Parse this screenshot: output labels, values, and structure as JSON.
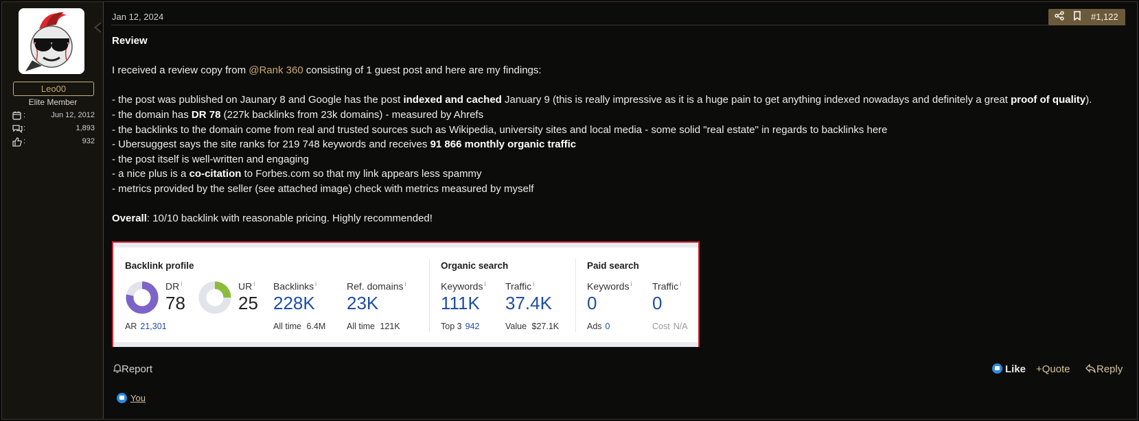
{
  "user": {
    "name": "Leo00",
    "title": "Elite Member",
    "stats": [
      {
        "icon": "calendar-icon",
        "value": "Jun 12, 2012"
      },
      {
        "icon": "messages-icon",
        "value": "1,893"
      },
      {
        "icon": "reactions-icon",
        "value": "932"
      }
    ]
  },
  "post": {
    "date": "Jan 12, 2024",
    "number": "#1,122",
    "heading": "Review",
    "intro_before": "I received a review copy from ",
    "mention": "@Rank 360",
    "intro_after": " consisting of 1 guest post and here are my findings:",
    "l1_a": "- the post was published on Jaunary 8 and Google has the post ",
    "l1_b": "indexed and cached",
    "l1_c": " January 9 (this is really impressive as it is a huge pain to get anything indexed nowadays and definitely a great ",
    "l1_d": "proof of quality",
    "l1_e": ").",
    "l2_a": "- the domain has ",
    "l2_b": "DR 78",
    "l2_c": " (227k backlinks from 23k domains) - measured by Ahrefs",
    "l3": "- the backlinks to the domain come from real and trusted sources such as Wikipedia, university sites and local media - some solid \"real estate\" in regards to backlinks here",
    "l4_a": "- Ubersuggest says the site ranks for 219 748 keywords and receives ",
    "l4_b": "91 866 monthly organic traffic",
    "l5": "- the post itself is well-written and engaging",
    "l6_a": "- a nice plus is a ",
    "l6_b": "co-citation",
    "l6_c": " to Forbes.com so that my link appears less spammy",
    "l7": "- metrics provided by the seller (see attached image) check with metrics measured by myself",
    "overall_a": "Overall",
    "overall_b": ": 10/10 backlink with reasonable pricing. Highly recommended!"
  },
  "attachment": {
    "backlink_profile": "Backlink profile",
    "organic_search": "Organic search",
    "paid_search": "Paid search",
    "dr_label": "DR",
    "dr_value": "78",
    "dr_fraction": 0.78,
    "ur_label": "UR",
    "ur_value": "25",
    "ur_fraction": 0.25,
    "ar_label": "AR",
    "ar_value": "21,301",
    "info": "i",
    "backlinks_label": "Backlinks",
    "backlinks_value": "228K",
    "backlinks_all_time": "All time",
    "backlinks_all_time_value": "6.4M",
    "refdomains_label": "Ref. domains",
    "refdomains_value": "23K",
    "refdomains_all_time": "All time",
    "refdomains_all_time_value": "121K",
    "keywords_label": "Keywords",
    "keywords_value": "111K",
    "top3_label": "Top 3",
    "top3_value": "942",
    "traffic_label": "Traffic",
    "traffic_value": "37.4K",
    "value_label": "Value",
    "value_value": "$27.1K",
    "paid_keywords_label": "Keywords",
    "paid_keywords_value": "0",
    "ads_label": "Ads",
    "ads_value": "0",
    "paid_traffic_label": "Traffic",
    "paid_traffic_value": "0",
    "cost_label": "Cost",
    "cost_value": "N/A"
  },
  "footer": {
    "report": "Report",
    "like": "Like",
    "quote": "Quote",
    "reply": "Reply",
    "reacted_by": "You"
  },
  "colors": {
    "accent_gold": "#c9a96c",
    "post_actions_bg": "#6b5a3a",
    "dr_purple": "#7c63c8",
    "ur_green": "#8cbc3a",
    "ahrefs_blue": "#1f4ea6",
    "attachment_border": "#d32430"
  }
}
